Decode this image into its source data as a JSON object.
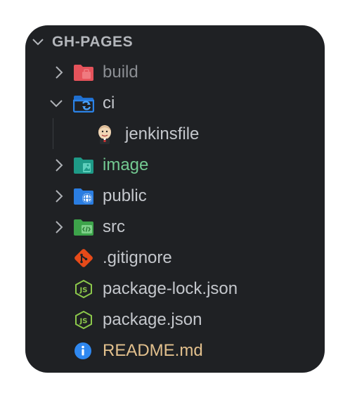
{
  "explorer": {
    "section_title": "GH-PAGES",
    "colors": {
      "panel_bg": "#1f2124",
      "default_text": "#c4c7cc",
      "dim_text": "#8b8e93",
      "green_text": "#73c991",
      "yellow_text": "#e2c08d"
    },
    "items": [
      {
        "label": "build",
        "kind": "folder",
        "state": "collapsed",
        "icon": "folder-build-icon",
        "color": "#8b8e93"
      },
      {
        "label": "ci",
        "kind": "folder",
        "state": "expanded",
        "icon": "folder-ci-icon",
        "color": "#c4c7cc"
      },
      {
        "label": "jenkinsfile",
        "kind": "file",
        "icon": "jenkins-icon",
        "color": "#c4c7cc"
      },
      {
        "label": "image",
        "kind": "folder",
        "state": "collapsed",
        "icon": "folder-image-icon",
        "color": "#73c991"
      },
      {
        "label": "public",
        "kind": "folder",
        "state": "collapsed",
        "icon": "folder-public-icon",
        "color": "#c4c7cc"
      },
      {
        "label": "src",
        "kind": "folder",
        "state": "collapsed",
        "icon": "folder-src-icon",
        "color": "#c4c7cc"
      },
      {
        "label": ".gitignore",
        "kind": "file",
        "icon": "git-icon",
        "color": "#c4c7cc"
      },
      {
        "label": "package-lock.json",
        "kind": "file",
        "icon": "nodejs-icon",
        "color": "#c4c7cc"
      },
      {
        "label": "package.json",
        "kind": "file",
        "icon": "nodejs-icon",
        "color": "#c4c7cc"
      },
      {
        "label": "README.md",
        "kind": "file",
        "icon": "info-icon",
        "color": "#e2c08d"
      }
    ]
  }
}
